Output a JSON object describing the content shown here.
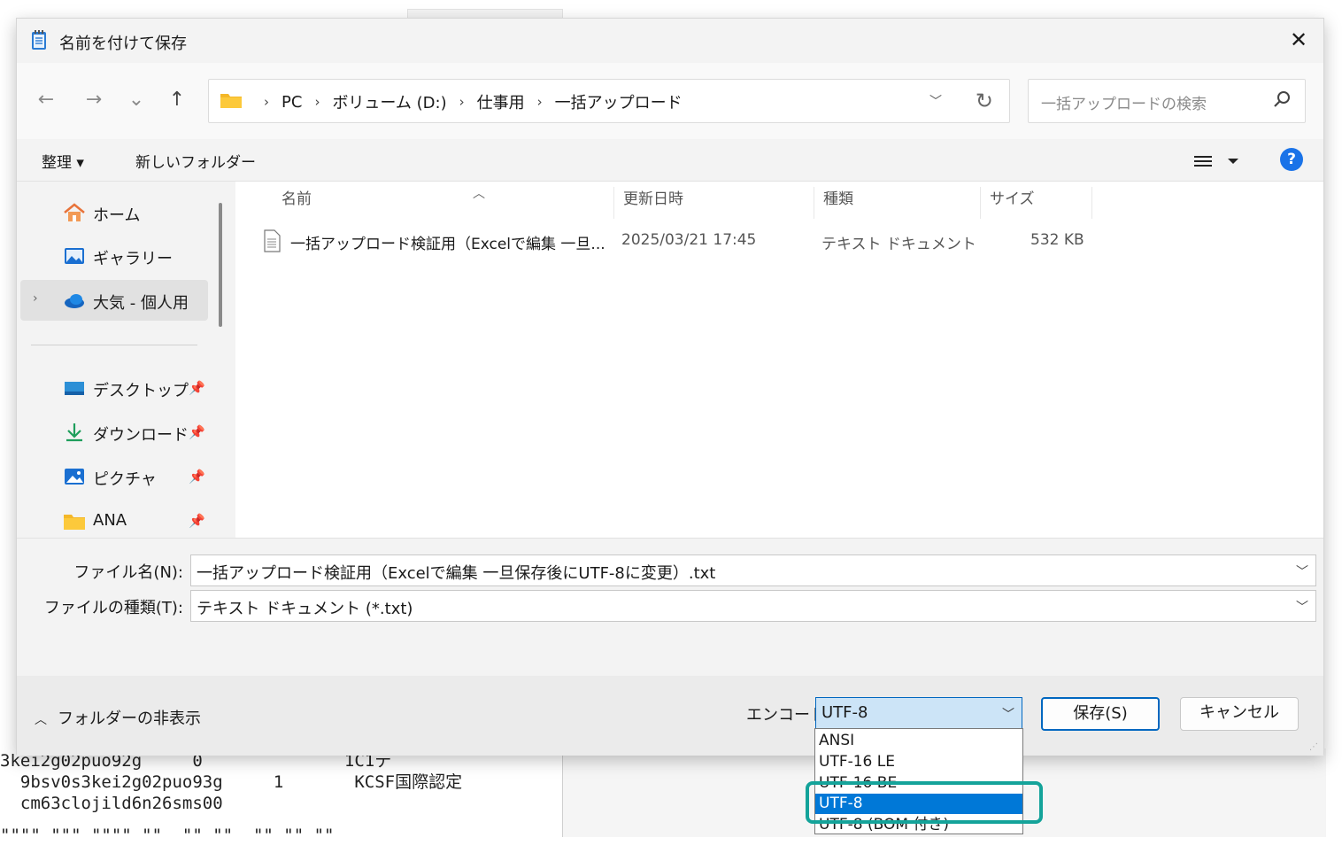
{
  "dialog": {
    "title": "名前を付けて保存",
    "close_symbol": "✕"
  },
  "nav": {
    "back": "←",
    "forward": "→",
    "recent": "⌄",
    "up": "↑"
  },
  "address": {
    "crumbs": [
      "PC",
      "ボリューム (D:)",
      "仕事用",
      "一括アップロード"
    ],
    "separator": "›"
  },
  "search": {
    "placeholder": "一括アップロードの検索"
  },
  "toolbar": {
    "organize": "整理 ▾",
    "new_folder": "新しいフォルダー",
    "help": "?"
  },
  "sidebar": {
    "items": [
      {
        "label": "ホーム"
      },
      {
        "label": "ギャラリー"
      },
      {
        "label": "大気 - 個人用"
      },
      {
        "label": "デスクトップ"
      },
      {
        "label": "ダウンロード"
      },
      {
        "label": "ピクチャ"
      },
      {
        "label": "ANA"
      }
    ]
  },
  "columns": {
    "name": "名前",
    "modified": "更新日時",
    "type": "種類",
    "size": "サイズ"
  },
  "files": [
    {
      "name": "一括アップロード検証用（Excelで編集 一旦...",
      "modified": "2025/03/21 17:45",
      "type": "テキスト ドキュメント",
      "size": "532 KB"
    }
  ],
  "fields": {
    "filename_label": "ファイル名(N):",
    "filename_value": "一括アップロード検証用（Excelで編集 一旦保存後にUTF-8に変更）.txt",
    "filetype_label": "ファイルの種類(T):",
    "filetype_value": "テキスト ドキュメント (*.txt)"
  },
  "footer": {
    "hide_folders": "フォルダーの非表示",
    "encoding_label": "エンコード:",
    "encoding_value": "UTF-8",
    "save": "保存(S)",
    "cancel": "キャンセル"
  },
  "encoding_options": [
    "ANSI",
    "UTF-16 LE",
    "UTF-16 BE",
    "UTF-8",
    "UTF-8 (BOM 付き)"
  ],
  "encoding_selected_index": 3,
  "background_text": {
    "line1": "3kei2g02puo92g     0              1C1テ",
    "line2": "  9bsv0s3kei2g02puo93g     1       KCSF国際認定",
    "line3": "  cm63clojild6n26sms00",
    "line4": "\"\"\"\" \"\"\" \"\"\"\" \"\"  \"\" \"\"  \"\" \"\" \"\""
  },
  "colors": {
    "accent": "#0067c0",
    "selection": "#0078d7",
    "highlight_box": "#14a39a"
  }
}
